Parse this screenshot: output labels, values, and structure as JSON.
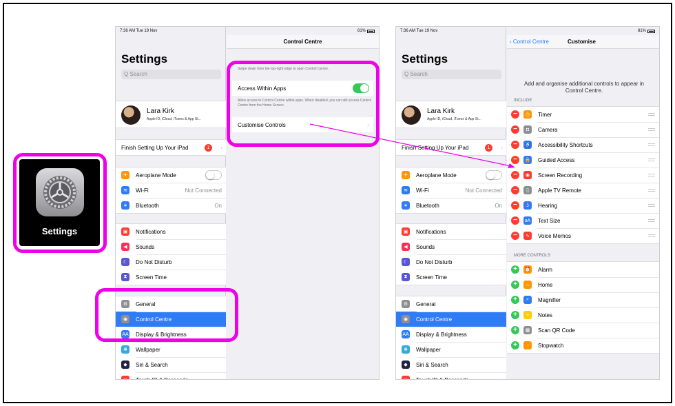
{
  "app_icon": {
    "label": "Settings"
  },
  "left_ipad": {
    "status": {
      "time": "7:36 AM  Tue 19 Nov",
      "battery": "81%"
    },
    "sidebar": {
      "title": "Settings",
      "search_placeholder": "Q Search",
      "profile": {
        "name": "Lara Kirk",
        "subtitle": "Apple ID, iCloud, iTunes & App St..."
      },
      "finish_setup": {
        "label": "Finish Setting Up Your iPad",
        "badge": "1"
      },
      "group1": [
        {
          "label": "Aeroplane Mode",
          "icon": "airplane-icon",
          "color": "#ff9500",
          "glyph": "✈"
        },
        {
          "label": "Wi-Fi",
          "value": "Not Connected",
          "icon": "wifi-icon",
          "color": "#2f7cf6",
          "glyph": "≋"
        },
        {
          "label": "Bluetooth",
          "value": "On",
          "icon": "bluetooth-icon",
          "color": "#2f7cf6",
          "glyph": "∗"
        }
      ],
      "group2": [
        {
          "label": "Notifications",
          "icon": "notifications-icon",
          "color": "#ff3b30",
          "glyph": "▣"
        },
        {
          "label": "Sounds",
          "icon": "sounds-icon",
          "color": "#ff2d55",
          "glyph": "◀"
        },
        {
          "label": "Do Not Disturb",
          "icon": "moon-icon",
          "color": "#5856d6",
          "glyph": "☾"
        },
        {
          "label": "Screen Time",
          "icon": "hourglass-icon",
          "color": "#5856d6",
          "glyph": "⧗"
        }
      ],
      "group3": [
        {
          "label": "General",
          "icon": "gear-icon",
          "color": "#8e8e93",
          "glyph": "⚙"
        },
        {
          "label": "Control Centre",
          "icon": "toggles-icon",
          "color": "#8e8e93",
          "glyph": "◉"
        },
        {
          "label": "Display & Brightness",
          "icon": "display-icon",
          "color": "#2f7cf6",
          "glyph": "AA"
        },
        {
          "label": "Wallpaper",
          "icon": "wallpaper-icon",
          "color": "#34aadc",
          "glyph": "❋"
        },
        {
          "label": "Siri & Search",
          "icon": "siri-icon",
          "color": "#222244",
          "glyph": "◆"
        },
        {
          "label": "Touch ID & Passcode",
          "icon": "fingerprint-icon",
          "color": "#ff3b30",
          "glyph": "◎"
        }
      ]
    },
    "detail": {
      "title": "Control Centre",
      "hint": "Swipe down from the top-right edge to open Control Centre.",
      "access_within_apps": "Access Within Apps",
      "access_footnote": "Allow access to Control Centre within apps. When disabled, you can still access Control Centre from the Home Screen.",
      "customise_controls": "Customise Controls"
    }
  },
  "right_ipad": {
    "status": {
      "time": "7:36 AM  Tue 19 Nov",
      "battery": "81%"
    },
    "nav": {
      "back": "Control Centre",
      "title": "Customise"
    },
    "intro": "Add and organise additional controls to appear in Control Centre.",
    "include_header": "INCLUDE",
    "include": [
      {
        "label": "Timer",
        "icon": "timer-icon",
        "color": "#ff9500",
        "glyph": "◷"
      },
      {
        "label": "Camera",
        "icon": "camera-icon",
        "color": "#8e8e93",
        "glyph": "◘"
      },
      {
        "label": "Accessibility Shortcuts",
        "icon": "accessibility-icon",
        "color": "#2f7cf6",
        "glyph": "♿"
      },
      {
        "label": "Guided Access",
        "icon": "lock-icon",
        "color": "#2f7cf6",
        "glyph": "🔒"
      },
      {
        "label": "Screen Recording",
        "icon": "record-icon",
        "color": "#ff3b30",
        "glyph": "◉"
      },
      {
        "label": "Apple TV Remote",
        "icon": "remote-icon",
        "color": "#8e8e93",
        "glyph": "▯"
      },
      {
        "label": "Hearing",
        "icon": "ear-icon",
        "color": "#2f7cf6",
        "glyph": "ʖ"
      },
      {
        "label": "Text Size",
        "icon": "text-size-icon",
        "color": "#2f7cf6",
        "glyph": "aA"
      },
      {
        "label": "Voice Memos",
        "icon": "waveform-icon",
        "color": "#ff3b30",
        "glyph": "∿"
      }
    ],
    "more_header": "MORE CONTROLS",
    "more": [
      {
        "label": "Alarm",
        "icon": "alarm-icon",
        "color": "#ff9500",
        "glyph": "⏰"
      },
      {
        "label": "Home",
        "icon": "home-icon",
        "color": "#ff9500",
        "glyph": "⌂"
      },
      {
        "label": "Magnifier",
        "icon": "magnifier-icon",
        "color": "#2f7cf6",
        "glyph": "⌕"
      },
      {
        "label": "Notes",
        "icon": "notes-icon",
        "color": "#ffcc00",
        "glyph": "≡"
      },
      {
        "label": "Scan QR Code",
        "icon": "qr-icon",
        "color": "#8e8e93",
        "glyph": "▦"
      },
      {
        "label": "Stopwatch",
        "icon": "stopwatch-icon",
        "color": "#ff9500",
        "glyph": "◔"
      }
    ]
  },
  "colors": {
    "highlight": "#ee00e8",
    "selected": "#2f7cf6",
    "toggle_on": "#34c759"
  }
}
